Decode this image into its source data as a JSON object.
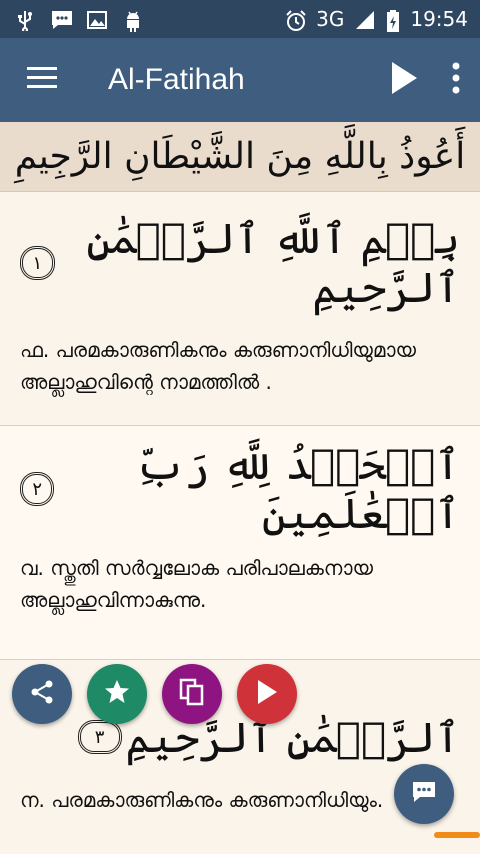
{
  "status_bar": {
    "network": "3G",
    "time": "19:54",
    "left_icons": [
      "usb-icon",
      "message-icon",
      "image-icon",
      "android-icon"
    ],
    "right_icons": [
      "alarm-icon",
      "signal-icon",
      "battery-icon"
    ]
  },
  "app_bar": {
    "title": "Al-Fatihah",
    "menu_icon": "hamburger-menu-icon",
    "play_icon": "play-icon",
    "more_icon": "more-vertical-icon",
    "background": "#3e5d7f"
  },
  "taawwudh": "أَعُوذُ بِاللَّهِ مِنَ الشَّيْطَانِ الرَّجِيمِ",
  "verses": [
    {
      "arabic": "بِسۡمِ ٱللَّهِ ٱلرَّحۡمَٰنِ ٱلرَّحِيمِ",
      "number": "١",
      "translation": "ഫ. പരമകാരുണികനും കരുണാനിധിയുമായ അല്ലാഹുവിന്റെ നാമത്തിൽ ."
    },
    {
      "arabic": "ٱلۡحَمۡدُ لِلَّهِ رَبِّ ٱلۡعَٰلَمِينَ",
      "number": "٢",
      "translation": "വ. സ്തുതി സർവ്വലോക പരിപാലകനായ അല്ലാഹുവിന്നാകുന്നു."
    },
    {
      "arabic": "ٱلرَّحۡمَٰنِ ٱلرَّحِيمِ",
      "number": "٣",
      "translation": "ന. പരമകാരുണികനും കരുണാനിധിയും."
    }
  ],
  "action_buttons": [
    {
      "name": "share-button",
      "icon": "share-icon",
      "color": "#3e5d7f"
    },
    {
      "name": "favorite-button",
      "icon": "star-icon",
      "color": "#1e8a66"
    },
    {
      "name": "copy-button",
      "icon": "copy-icon",
      "color": "#8e1482"
    },
    {
      "name": "play-verse-button",
      "icon": "play-icon",
      "color": "#cf3238"
    }
  ],
  "chat_button": {
    "icon": "chat-icon",
    "color": "#3e5d7f"
  },
  "accent_orange": "#f28c18"
}
